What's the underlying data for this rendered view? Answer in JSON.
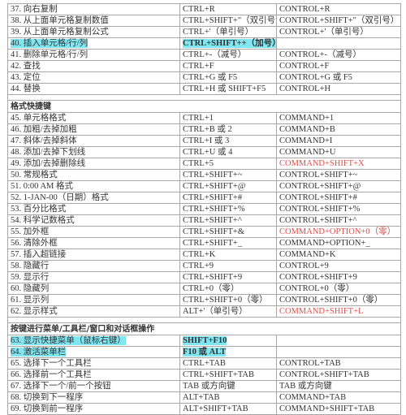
{
  "colors": {
    "highlight": "#7fe6f2",
    "red_text": "#e0504a"
  },
  "groups": [
    {
      "title": "",
      "rows": [
        {
          "action": "37. 向右复制",
          "win": "CTRL+R",
          "mac": "CONTROL+R"
        },
        {
          "action": "38. 从上面单元格复制数值",
          "win": "CTRL+SHIFT+\"（双引号）",
          "mac": "CONTROL+SHIFT+\"（双引号）"
        },
        {
          "action": "39. 从上面单元格复制公式",
          "win": "CTRL+'（单引号）",
          "mac": "CONTROL+'（单引号）"
        },
        {
          "action": "40. 插入单元格/行/列",
          "win": "CTRL+SHIFT++（加号）",
          "mac": "",
          "highlight": true
        },
        {
          "action": "41. 删除单元格/行/列",
          "win": "CTRL+-（减号）",
          "mac": "CONTROL+-（减号）"
        },
        {
          "action": "42. 查找",
          "win": "CTRL+F",
          "mac": "CONTROL+F"
        },
        {
          "action": "43. 定位",
          "win": "CTRL+G 或 F5",
          "mac": "CONTROL+G 或 F5"
        },
        {
          "action": "44. 替换",
          "win": "CTRL+H 或 SHIFT+F5",
          "mac": "CONTROL+H"
        }
      ]
    },
    {
      "title": "格式快捷键",
      "rows": [
        {
          "action": "45. 单元格格式",
          "win": "CTRL+1",
          "mac": "COMMAND+1"
        },
        {
          "action": "46. 加粗/去掉加粗",
          "win": "CTRL+B 或 2",
          "mac": "COMMAND+B"
        },
        {
          "action": "47. 斜体/去掉斜体",
          "win": "CTRL+I 或 3",
          "mac": "COMMAND+I"
        },
        {
          "action": "48. 添加/去掉下划线",
          "win": "CTRL+U 或 4",
          "mac": "COMMAND+U"
        },
        {
          "action": "49. 添加/去掉删除线",
          "win": "CTRL+5",
          "mac": "COMMAND+SHIFT+X",
          "mac_red": true
        },
        {
          "action": "50. 常规格式",
          "win": "CTRL+SHIFT+~",
          "mac": "CONTROL+SHIFT+~"
        },
        {
          "action": "51. 0:00 AM 格式",
          "win": "CTRL+SHIFT+@",
          "mac": "CONTROL+SHIFT+@"
        },
        {
          "action": "52. 1-JAN-00（日期）格式",
          "win": "CTRL+SHIFT+#",
          "mac": "CONTROL+SHIFT+#"
        },
        {
          "action": "53. 百分比格式",
          "win": "CTRL+SHIFT+%",
          "mac": "CONTROL+SHIFT+%"
        },
        {
          "action": "54. 科学记数格式",
          "win": "CTRL+SHIFT+^",
          "mac": "CONTROL+SHIFT+^"
        },
        {
          "action": "55. 加外框",
          "win": "CTRL+SHIFT+&",
          "mac": "COMMAND+OPTION+0（零）",
          "mac_red": true
        },
        {
          "action": "56. 清除外框",
          "win": "CTRL+SHIFT+_",
          "mac": "COMMAND+OPTION+_"
        },
        {
          "action": "57. 插入超链接",
          "win": "CTRL+K",
          "mac": "COMMAND+K"
        },
        {
          "action": "58. 隐藏行",
          "win": "CTRL+9",
          "mac": "CONTROL+9"
        },
        {
          "action": "59. 显示行",
          "win": "CTRL+SHIFT+9",
          "mac": "CONTROL+SHIFT+9"
        },
        {
          "action": "60. 隐藏列",
          "win": "CTRL+0（零）",
          "mac": "CONTROL+0（零）"
        },
        {
          "action": "61. 显示列",
          "win": "CTRL+SHIFT+0（零）",
          "mac": "CONTROL+SHIFT+0（零）"
        },
        {
          "action": "62. 显示样式",
          "win": "ALT+'（单引号）",
          "mac": "COMMAND+SHIFT+L",
          "mac_red": true
        }
      ]
    },
    {
      "title": "按键进行菜单/工具栏/窗口和对话框操作",
      "rows": [
        {
          "action": "63. 显示快捷菜单（鼠标右键）",
          "win": "SHIFT+F10",
          "mac": "",
          "highlight": true
        },
        {
          "action": "64. 激活菜单栏",
          "win": "F10 或 ALT",
          "mac": "",
          "highlight": true
        },
        {
          "action": "65. 选择下一个工具栏",
          "win": "CTRL+TAB",
          "mac": "CONTROL+TAB"
        },
        {
          "action": "66. 选择前一个工具栏",
          "win": "CTRL+SHIFT+TAB",
          "mac": "CONTROL+SHIFT+TAB"
        },
        {
          "action": "67. 选择下一个/前一个按钮",
          "win": "TAB 或方向键",
          "mac": "TAB 或方向键"
        },
        {
          "action": "68. 切换到下一程序",
          "win": "ALT+TAB",
          "mac": "COMMAND+TAB"
        },
        {
          "action": "69. 切换到前一程序",
          "win": "ALT+SHIFT+TAB",
          "mac": "COMMAND+SHIFT+TAB"
        }
      ]
    }
  ]
}
